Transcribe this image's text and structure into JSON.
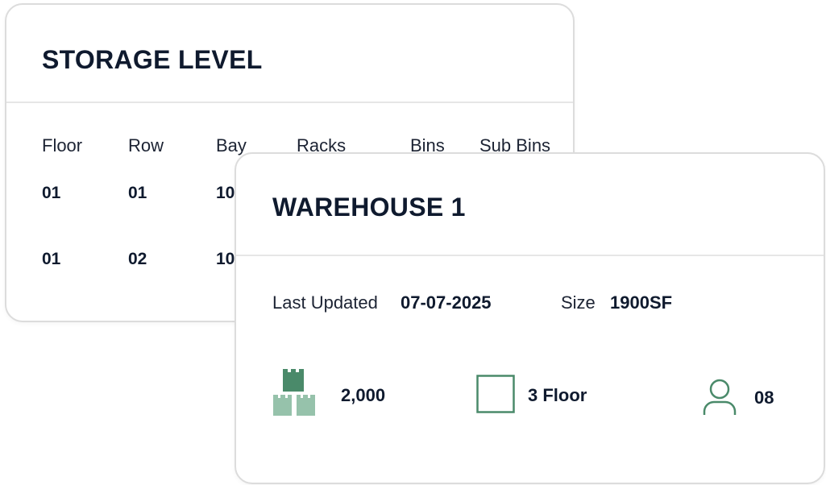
{
  "storage_level": {
    "title": "STORAGE LEVEL",
    "columns": [
      "Floor",
      "Row",
      "Bay",
      "Racks",
      "Bins",
      "Sub Bins"
    ],
    "rows": [
      {
        "floor": "01",
        "row": "01",
        "bay": "10"
      },
      {
        "floor": "01",
        "row": "02",
        "bay": "10"
      }
    ]
  },
  "warehouse": {
    "title": "WAREHOUSE 1",
    "last_updated_label": "Last Updated",
    "last_updated_value": "07-07-2025",
    "size_label": "Size",
    "size_value": "1900SF",
    "stats": {
      "inventory": {
        "icon": "boxes-icon",
        "value": "2,000"
      },
      "floors": {
        "icon": "square-icon",
        "value": "3 Floor"
      },
      "staff": {
        "icon": "user-icon",
        "value": "08"
      }
    }
  },
  "colors": {
    "accent_dark": "#4a8a6a",
    "accent_light": "#96c2ab",
    "text": "#0f1a2e",
    "border": "#dcdcdc"
  }
}
